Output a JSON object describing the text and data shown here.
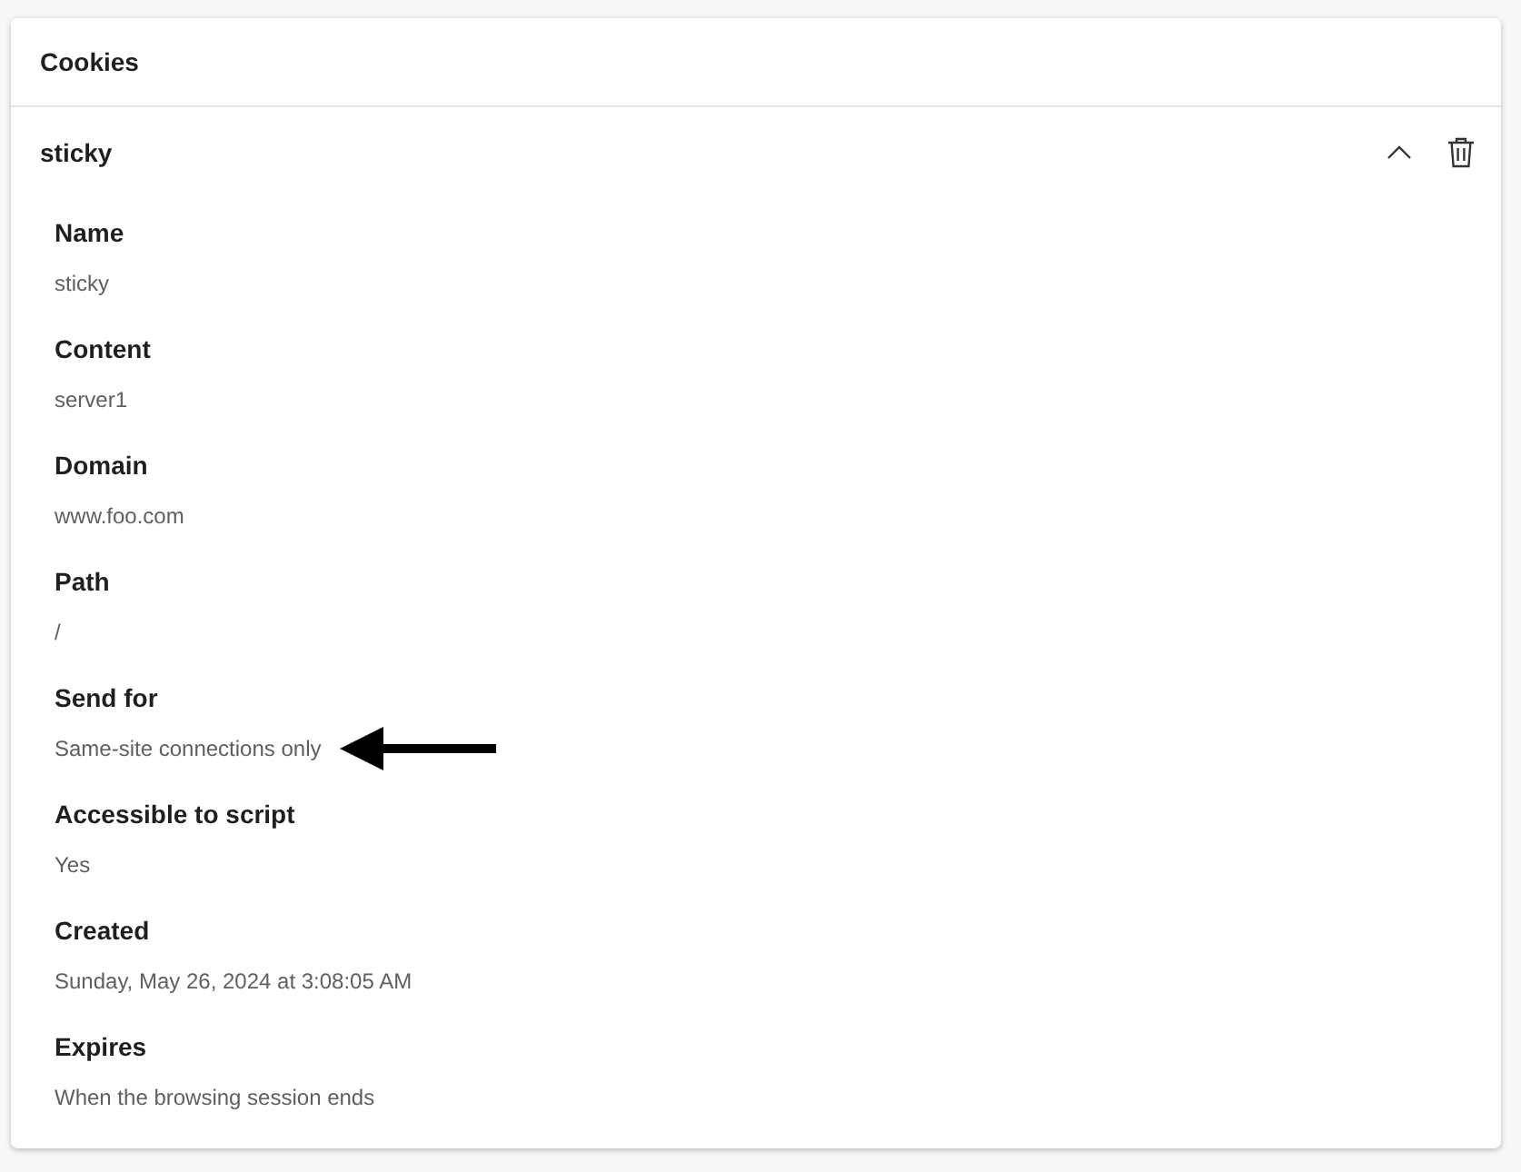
{
  "panel": {
    "title": "Cookies"
  },
  "cookie": {
    "name": "sticky",
    "expanded": true,
    "fields": [
      {
        "label": "Name",
        "value": "sticky"
      },
      {
        "label": "Content",
        "value": "server1"
      },
      {
        "label": "Domain",
        "value": "www.foo.com"
      },
      {
        "label": "Path",
        "value": "/"
      },
      {
        "label": "Send for",
        "value": "Same-site connections only",
        "annotated": true
      },
      {
        "label": "Accessible to script",
        "value": "Yes"
      },
      {
        "label": "Created",
        "value": "Sunday, May 26, 2024 at 3:08:05 AM"
      },
      {
        "label": "Expires",
        "value": "When the browsing session ends"
      }
    ]
  }
}
